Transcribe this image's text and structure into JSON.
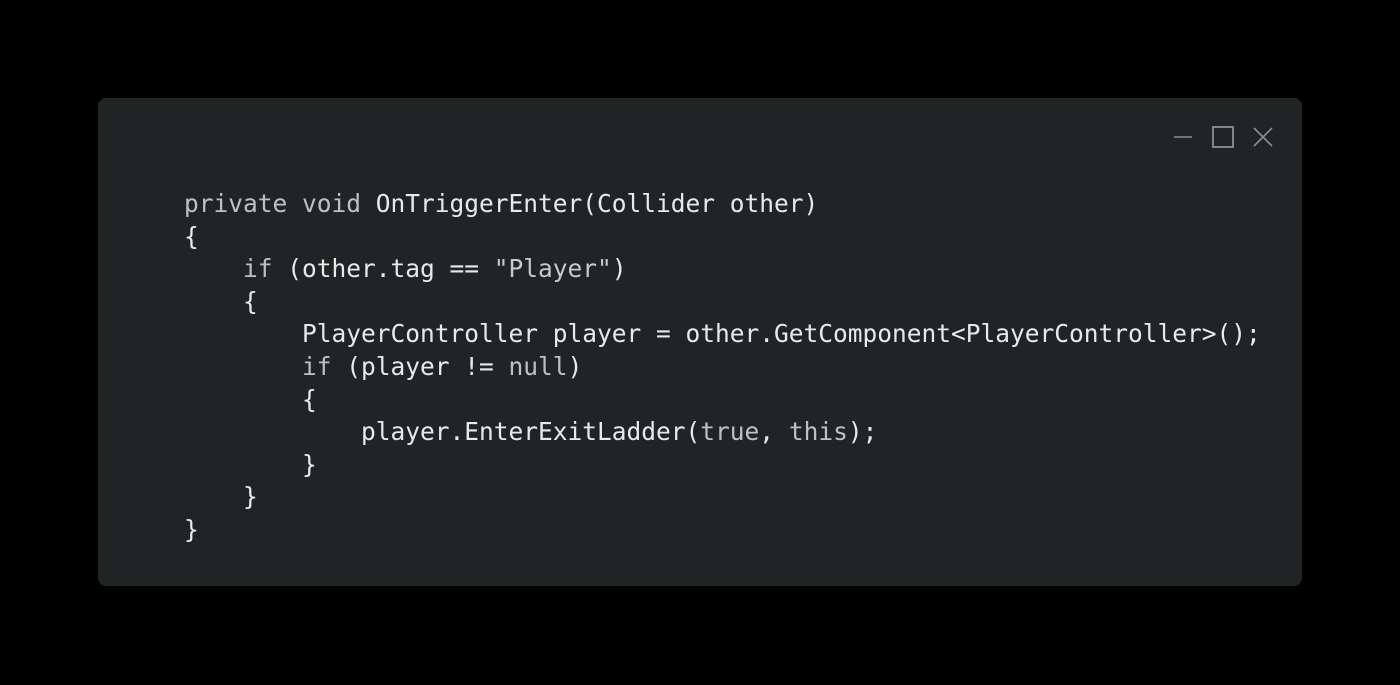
{
  "window": {
    "background": "#212424",
    "controls": [
      {
        "name": "minimize-icon"
      },
      {
        "name": "maximize-icon"
      },
      {
        "name": "close-icon"
      }
    ]
  },
  "code": {
    "language": "csharp",
    "lines": [
      {
        "indent": 0,
        "tokens": [
          {
            "t": "kw",
            "v": "private"
          },
          {
            "t": "plain",
            "v": " "
          },
          {
            "t": "kw",
            "v": "void"
          },
          {
            "t": "plain",
            "v": " OnTriggerEnter(Collider other)"
          }
        ]
      },
      {
        "indent": 0,
        "tokens": [
          {
            "t": "plain",
            "v": "{"
          }
        ]
      },
      {
        "indent": 1,
        "tokens": [
          {
            "t": "kw",
            "v": "if"
          },
          {
            "t": "plain",
            "v": " (other.tag == "
          },
          {
            "t": "str",
            "v": "\"Player\""
          },
          {
            "t": "plain",
            "v": ")"
          }
        ]
      },
      {
        "indent": 1,
        "tokens": [
          {
            "t": "plain",
            "v": "{"
          }
        ]
      },
      {
        "indent": 2,
        "tokens": [
          {
            "t": "plain",
            "v": "PlayerController player = other.GetComponent<PlayerController>();"
          }
        ]
      },
      {
        "indent": 2,
        "tokens": [
          {
            "t": "kw",
            "v": "if"
          },
          {
            "t": "plain",
            "v": " (player != "
          },
          {
            "t": "kw",
            "v": "null"
          },
          {
            "t": "plain",
            "v": ")"
          }
        ]
      },
      {
        "indent": 2,
        "tokens": [
          {
            "t": "plain",
            "v": "{"
          }
        ]
      },
      {
        "indent": 3,
        "tokens": [
          {
            "t": "plain",
            "v": "player.EnterExitLadder("
          },
          {
            "t": "kw",
            "v": "true"
          },
          {
            "t": "plain",
            "v": ", "
          },
          {
            "t": "kw",
            "v": "this"
          },
          {
            "t": "plain",
            "v": ");"
          }
        ]
      },
      {
        "indent": 2,
        "tokens": [
          {
            "t": "plain",
            "v": "}"
          }
        ]
      },
      {
        "indent": 1,
        "tokens": [
          {
            "t": "plain",
            "v": "}"
          }
        ]
      },
      {
        "indent": 0,
        "tokens": [
          {
            "t": "plain",
            "v": "}"
          }
        ]
      }
    ]
  }
}
